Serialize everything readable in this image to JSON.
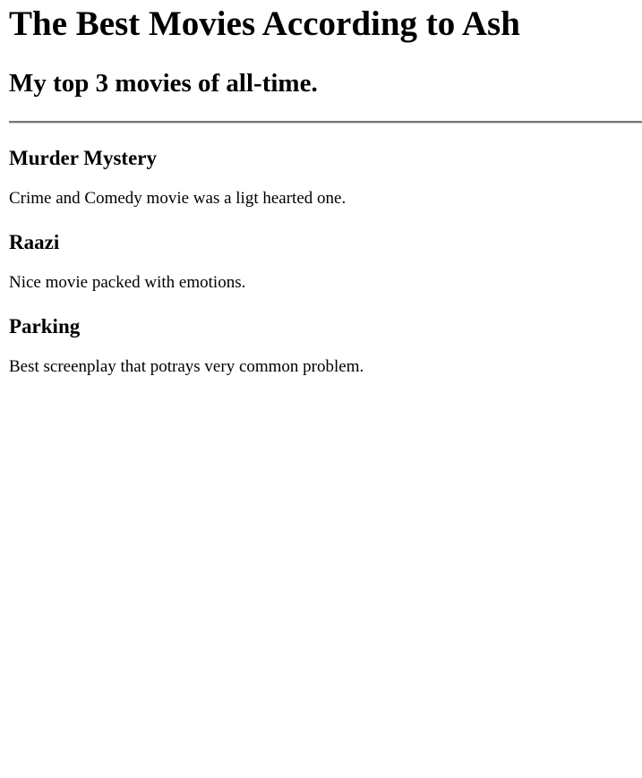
{
  "page": {
    "title": "The Best Movies According to Ash",
    "subtitle": "My top 3 movies of all-time."
  },
  "movies": [
    {
      "title": "Murder Mystery",
      "description": "Crime and Comedy movie was a ligt hearted one."
    },
    {
      "title": "Raazi",
      "description": "Nice movie packed with emotions."
    },
    {
      "title": "Parking",
      "description": "Best screenplay that potrays very common problem."
    }
  ]
}
